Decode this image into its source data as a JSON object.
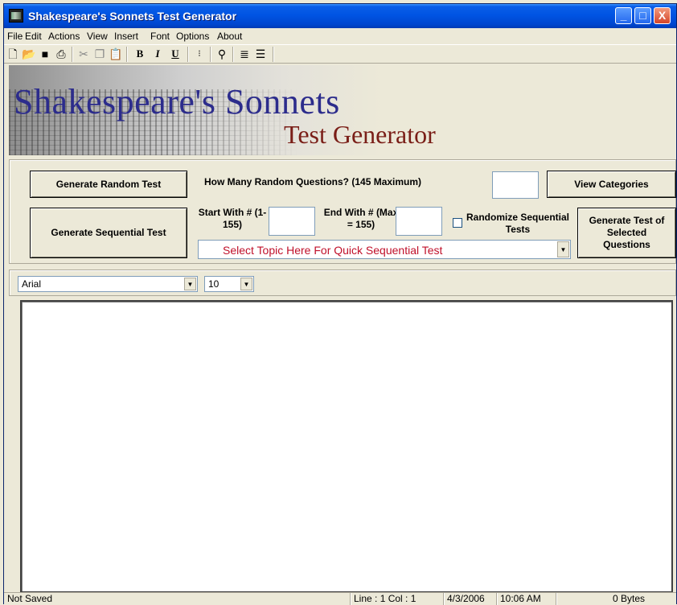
{
  "window": {
    "title": "Shakespeare's Sonnets Test Generator",
    "controls": {
      "minimize": "_",
      "maximize": "□",
      "close": "X"
    }
  },
  "menu": [
    "File",
    "Edit",
    "Actions",
    "View",
    "Insert",
    "Font",
    "Options",
    "About"
  ],
  "toolbar": {
    "icons": [
      "new-document-icon",
      "open-folder-icon",
      "save-disk-icon",
      "print-icon",
      "cut-scissors-icon",
      "copy-icon",
      "paste-icon",
      "bold-icon",
      "italic-icon",
      "underline-icon",
      "bullets-icon",
      "find-binoculars-icon",
      "align-left-icon",
      "align-center-icon"
    ],
    "bold": "B",
    "italic": "I",
    "underline": "U"
  },
  "banner": {
    "line1": "Shakespeare's Sonnets",
    "line2": "Test Generator"
  },
  "panel": {
    "random_button": "Generate Random Test",
    "how_many_label": "How Many Random Questions? (145 Maximum)",
    "how_many_value": "",
    "view_categories_button": "View Categories",
    "sequential_button": "Generate Sequential Test",
    "start_with_label": "Start With # (1-155)",
    "start_with_value": "",
    "end_with_label": "End With # (Max = 155)",
    "end_with_value": "",
    "randomize_label": "Randomize Sequential Tests",
    "randomize_checked": false,
    "generate_selected_button": "Generate Test of Selected Questions",
    "topic_select": "Select Topic Here For Quick Sequential Test",
    "topic_color": "#c0102a"
  },
  "fontbar": {
    "font_name": "Arial",
    "font_size": "10"
  },
  "editor": {
    "content": ""
  },
  "status": {
    "saved": "Not Saved",
    "line_col": "Line : 1   Col : 1",
    "date": "4/3/2006",
    "time": "10:06 AM",
    "size": "0 Bytes"
  }
}
